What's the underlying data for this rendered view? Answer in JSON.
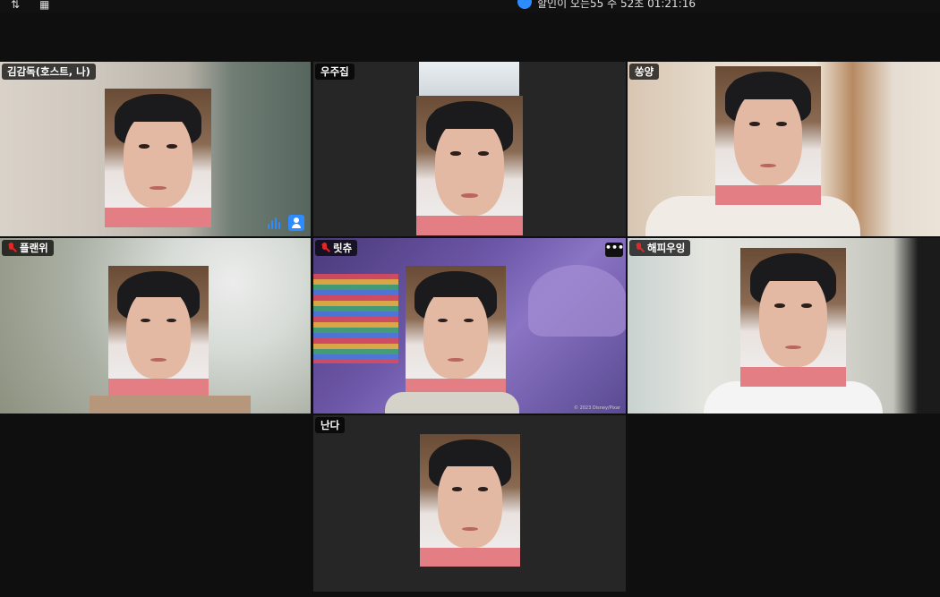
{
  "top_bar": {
    "title": "할인이 오는55 수 52초 01:21:16"
  },
  "participants": [
    {
      "name": "김감독(호스트, 나)",
      "muted": false
    },
    {
      "name": "우주집",
      "muted": false
    },
    {
      "name": "쏭양",
      "muted": false
    },
    {
      "name": "플랜위",
      "muted": true
    },
    {
      "name": "릿츄",
      "muted": true
    },
    {
      "name": "해피우잉",
      "muted": true
    },
    {
      "name": "난다",
      "muted": false
    }
  ],
  "tile_menu_label": "•••",
  "copyright_text": "© 2023 Disney/Pixar",
  "colors": {
    "accent": "#2d8cff",
    "muted_mic": "#e02828",
    "tile_bg": "#262626",
    "page_bg": "#0f0f0f"
  },
  "icons": {
    "speaker_indicator": "audio-wave-icon",
    "spotlight": "person-icon",
    "muted": "mic-muted-icon",
    "more": "more-options-icon"
  }
}
